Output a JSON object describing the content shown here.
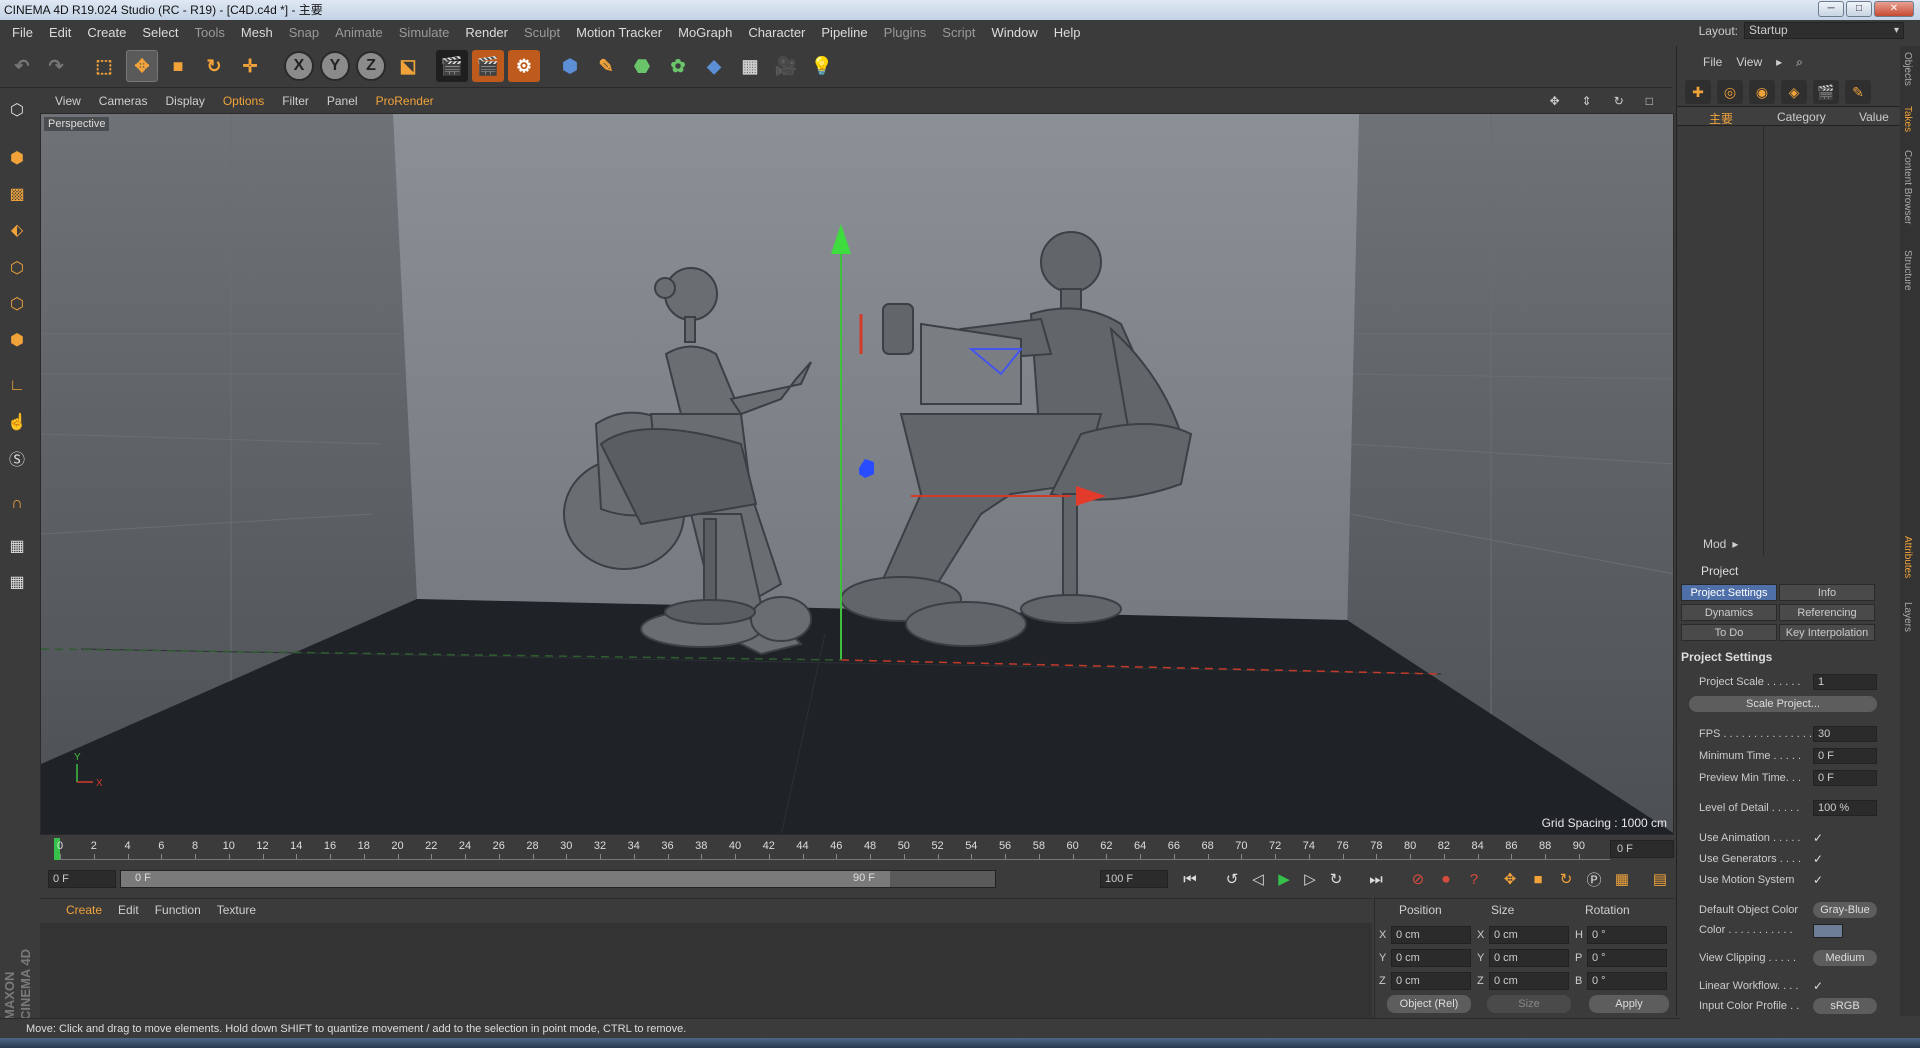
{
  "window": {
    "title": "CINEMA 4D R19.024 Studio (RC - R19) - [C4D.c4d *] - 主要"
  },
  "menu": [
    "File",
    "Edit",
    "Create",
    "Select",
    "Tools",
    "Mesh",
    "Snap",
    "Animate",
    "Simulate",
    "Render",
    "Sculpt",
    "Motion Tracker",
    "MoGraph",
    "Character",
    "Pipeline",
    "Plugins",
    "Script",
    "Window",
    "Help"
  ],
  "layout": {
    "label": "Layout:",
    "value": "Startup"
  },
  "toolbar": {
    "x_label": "X",
    "y_label": "Y",
    "z_label": "Z"
  },
  "viewport": {
    "menu": [
      "View",
      "Cameras",
      "Display",
      "Options",
      "Filter",
      "Panel",
      "ProRender"
    ],
    "label": "Perspective",
    "grid_info": "Grid Spacing : 1000 cm",
    "axis_x": "X",
    "axis_y": "Y"
  },
  "timeline": {
    "ticks": [
      "0",
      "2",
      "4",
      "6",
      "8",
      "10",
      "12",
      "14",
      "16",
      "18",
      "20",
      "22",
      "24",
      "26",
      "28",
      "30",
      "32",
      "34",
      "36",
      "38",
      "40",
      "42",
      "44",
      "46",
      "48",
      "50",
      "52",
      "54",
      "56",
      "58",
      "60",
      "62",
      "64",
      "66",
      "68",
      "70",
      "72",
      "74",
      "76",
      "78",
      "80",
      "82",
      "84",
      "86",
      "88",
      "90"
    ],
    "current_frame": "0 F"
  },
  "transport": {
    "start": "0 F",
    "slider_left": "0 F",
    "slider_right": "90 F",
    "end": "100 F"
  },
  "material": {
    "menu": [
      "Create",
      "Edit",
      "Function",
      "Texture"
    ]
  },
  "brand": "MAXON CINEMA 4D",
  "coordinates": {
    "position_label": "Position",
    "size_label": "Size",
    "rotation_label": "Rotation",
    "rows": [
      {
        "p": "X",
        "pv": "0 cm",
        "s": "X",
        "sv": "0 cm",
        "r": "H",
        "rv": "0 °"
      },
      {
        "p": "Y",
        "pv": "0 cm",
        "s": "Y",
        "sv": "0 cm",
        "r": "P",
        "rv": "0 °"
      },
      {
        "p": "Z",
        "pv": "0 cm",
        "s": "Z",
        "sv": "0 cm",
        "r": "B",
        "rv": "0 °"
      }
    ],
    "mode": "Object (Rel)",
    "size_mode": "Size",
    "apply": "Apply"
  },
  "status": "Move: Click and drag to move elements. Hold down SHIFT to quantize movement / add to the selection in point mode, CTRL to remove.",
  "objects": {
    "menu": [
      "File",
      "View"
    ],
    "name_col": "主要",
    "category_col": "Category",
    "value_col": "Value"
  },
  "right_tabs": [
    "Objects",
    "Takes",
    "Content Browser",
    "Structure",
    "Attributes",
    "Layers"
  ],
  "attributes": {
    "mode": "Mod",
    "object": "Project",
    "tabs": [
      "Project Settings",
      "Info",
      "Dynamics",
      "Referencing",
      "To Do",
      "Key Interpolation"
    ],
    "section": "Project Settings",
    "project_scale_label": "Project Scale . . . . . .",
    "project_scale": "1",
    "scale_button": "Scale Project...",
    "fps_label": "FPS . . . . . . . . . . . . . . .",
    "fps": "30",
    "min_time_label": "Minimum Time . . . . .",
    "min_time": "0 F",
    "preview_min_label": "Preview Min Time. . .",
    "preview_min": "0 F",
    "lod_label": "Level of Detail . . . . .",
    "lod": "100 %",
    "use_animation": "Use Animation . . . . .",
    "use_generators": "Use Generators . . . .",
    "use_motion": "Use Motion System",
    "check": "✓",
    "default_color_label": "Default Object Color",
    "default_color": "Gray-Blue",
    "color_label": "Color . . . . . . . . . . .",
    "view_clipping_label": "View Clipping . . . . .",
    "view_clipping": "Medium",
    "linear_workflow": "Linear Workflow. . . .",
    "input_profile_label": "Input Color Profile . .",
    "input_profile": "sRGB"
  }
}
